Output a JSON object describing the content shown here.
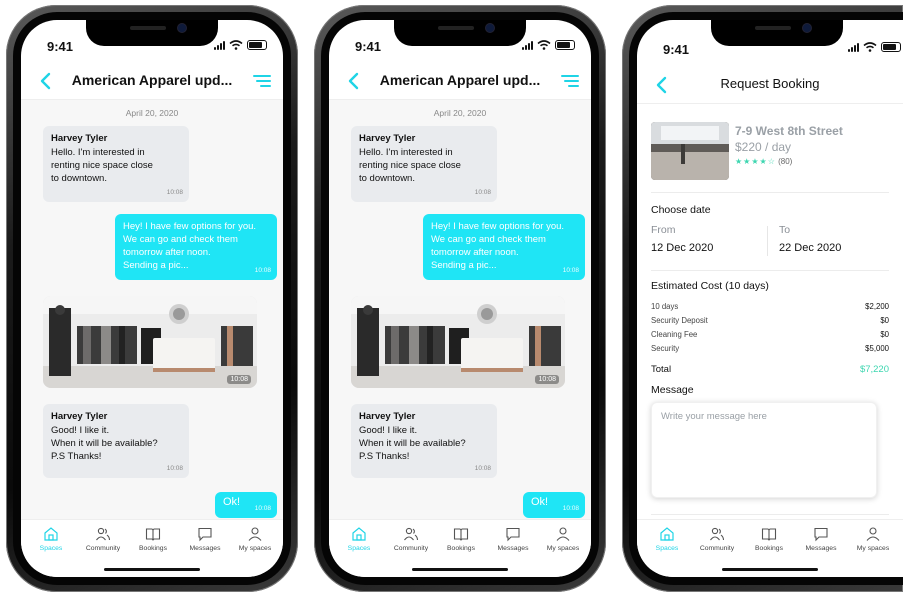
{
  "status": {
    "time": "9:41"
  },
  "chat": {
    "title": "American Apparel upd...",
    "title_short": "American Apparel upd...",
    "date": "April 20, 2020",
    "messages": [
      {
        "sender": "Harvey Tyler",
        "lines": [
          "Hello. I'm interested in",
          "renting nice space close",
          "to downtown."
        ],
        "time": "10:08"
      },
      {
        "lines": [
          "Hey! I have few options for you.",
          "We can go and check them",
          "tomorrow after noon.",
          "Sending a pic..."
        ],
        "time": "10:08"
      },
      {
        "image": "showroom-photo",
        "time": "10:08"
      },
      {
        "sender": "Harvey Tyler",
        "lines": [
          "Good! I like it.",
          "When it will be available?",
          "P.S Thanks!"
        ],
        "time": "10:08"
      },
      {
        "lines": [
          "Ok!"
        ],
        "time": "10:08"
      }
    ]
  },
  "tabs": [
    {
      "label": "Spaces",
      "icon": "home-icon",
      "active": true
    },
    {
      "label": "Community",
      "icon": "people-icon",
      "active": false
    },
    {
      "label": "Bookings",
      "icon": "book-icon",
      "active": false
    },
    {
      "label": "Messages",
      "icon": "message-icon",
      "active": false
    },
    {
      "label": "My spaces",
      "icon": "user-icon",
      "active": false
    }
  ],
  "booking": {
    "title": "Request Booking",
    "property": {
      "name": "7-9 West 8th Street",
      "price": "$220 / day",
      "stars": "★★★★☆",
      "rating_count": "(80)"
    },
    "choose_date": "Choose date",
    "from_label": "From",
    "to_label": "To",
    "from_value": "12 Dec 2020",
    "to_value": "22 Dec 2020",
    "estimated_cost": "Estimated Cost (10 days)",
    "costs": [
      {
        "label": "10 days",
        "value": "$2,200"
      },
      {
        "label": "Security Deposit",
        "value": "$0"
      },
      {
        "label": "Cleaning Fee",
        "value": "$0"
      },
      {
        "label": "Security",
        "value": "$5,000"
      }
    ],
    "total_label": "Total",
    "total_value": "$7,220",
    "message_label": "Message",
    "message_placeholder": "Write your message here"
  },
  "colors": {
    "accent": "#1fe5f5",
    "accent_text": "#1fd4e6",
    "green": "#3dd6b0",
    "bubble_in": "#e9ebee",
    "chat_bg": "#f7f7f7"
  }
}
